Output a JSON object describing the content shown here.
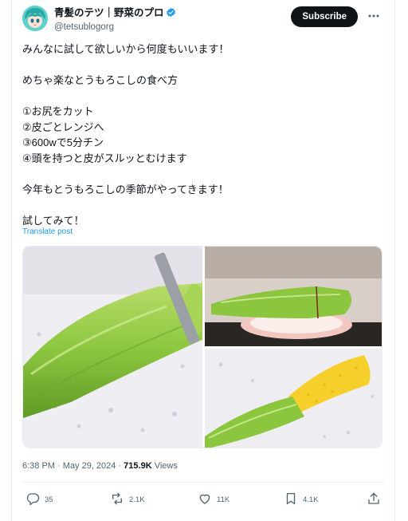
{
  "author": {
    "display_name": "青髪のテツ｜野菜のプロ",
    "handle": "@tetsublogorg"
  },
  "subscribe_label": "Subscribe",
  "tweet": {
    "text": "みんなに試して欲しいから何度もいいます！\n\nめちゃ楽なとうもろこしの食べ方\n\n①お尻をカット\n②皮ごとレンジへ\n③600wで5分チン\n④頭を持つと皮がスルッとむけます\n\n今年もとうもろこしの季節がやってきます！\n\n試してみて！",
    "translate_label": "Translate post",
    "time": "6:38 PM · May 29, 2024 · ",
    "views_count": "715.9K",
    "views_label": " Views"
  },
  "actions": {
    "replies": "35",
    "reposts": "2.1K",
    "likes": "11K",
    "bookmarks": "4.1K"
  },
  "colors": {
    "link": "#1d9bf0",
    "verified": "#1d9bf0",
    "subscribe_bg": "#0f1419",
    "muted": "#536471"
  },
  "icons": [
    "verified-badge-icon",
    "more-icon",
    "reply-icon",
    "repost-icon",
    "like-icon",
    "bookmark-icon",
    "share-icon"
  ]
}
